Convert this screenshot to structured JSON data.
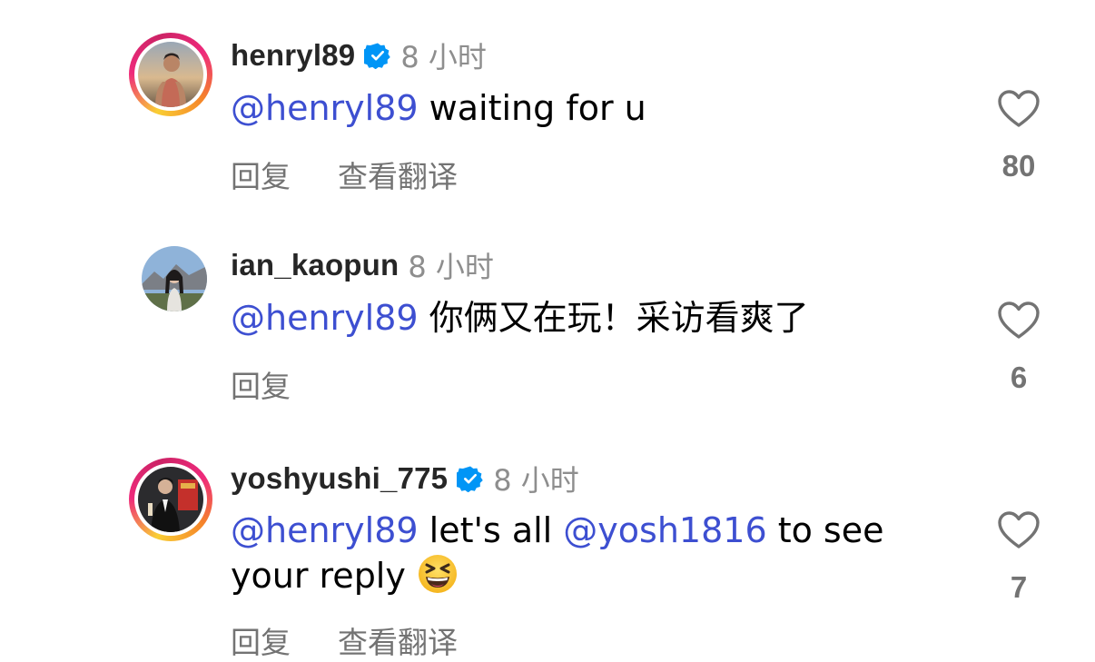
{
  "comments": [
    {
      "username": "henryl89",
      "verified": true,
      "story_ring": true,
      "time": "8 小时",
      "mention": "@henryl89",
      "text": " waiting for u",
      "reply_label": "回复",
      "translate_label": "查看翻译",
      "likes": "80"
    },
    {
      "username": "ian_kaopun",
      "verified": false,
      "story_ring": false,
      "time": "8 小时",
      "mention": "@henryl89",
      "text": " 你俩又在玩！采访看爽了",
      "reply_label": "回复",
      "likes": "6"
    },
    {
      "username": "yoshyushi_775",
      "verified": true,
      "story_ring": true,
      "time": "8 小时",
      "mention": "@henryl89",
      "text_a": " let's all ",
      "mention_2": "@yosh1816",
      "text_b": " to see your reply",
      "emoji": "grinning-squinting-face",
      "reply_label": "回复",
      "translate_label": "查看翻译",
      "likes": "7"
    }
  ],
  "colors": {
    "mention": "#3d4fd1",
    "verified": "#0095f6",
    "muted": "#737373",
    "time": "#8e8e8e"
  },
  "icons": [
    "verified-badge-icon",
    "heart-icon"
  ]
}
